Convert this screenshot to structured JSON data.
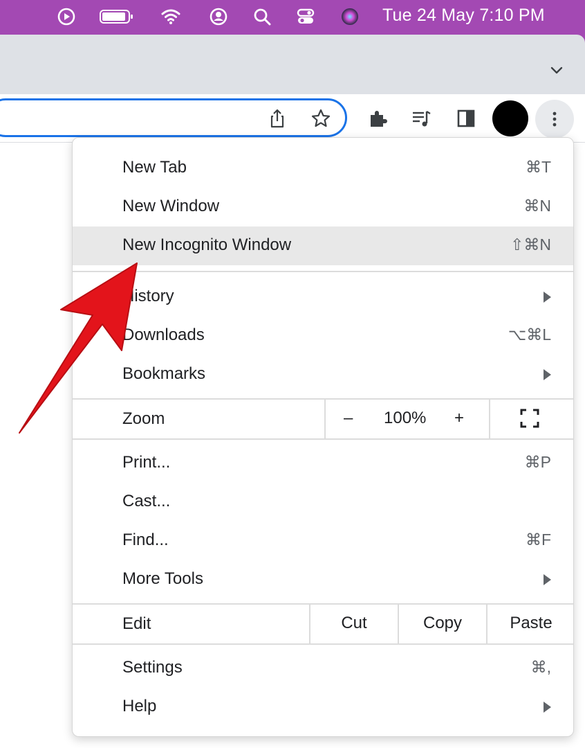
{
  "menubar": {
    "clock": "Tue 24 May  7:10 PM",
    "icons": [
      "play-circle-icon",
      "battery-icon",
      "wifi-icon",
      "user-account-icon",
      "spotlight-search-icon",
      "control-center-icon",
      "siri-icon"
    ],
    "background": "#a349b3"
  },
  "tabstrip": {
    "chevron_icon": "chevron-down-icon"
  },
  "toolbar": {
    "omnibox_icons": [
      "share-icon",
      "bookmark-star-icon"
    ],
    "icons": [
      "extensions-icon",
      "media-controls-icon",
      "side-panel-icon",
      "profile-avatar",
      "chrome-menu-icon"
    ],
    "omnibox_border": "#1a73e8"
  },
  "menu": {
    "groups": [
      {
        "items": [
          {
            "label": "New Tab",
            "shortcut": "⌘T"
          },
          {
            "label": "New Window",
            "shortcut": "⌘N"
          },
          {
            "label": "New Incognito Window",
            "shortcut": "⇧⌘N",
            "highlighted": true
          }
        ]
      },
      {
        "items": [
          {
            "label": "History",
            "submenu": true
          },
          {
            "label": "Downloads",
            "shortcut": "⌥⌘L"
          },
          {
            "label": "Bookmarks",
            "submenu": true
          }
        ]
      }
    ],
    "zoom": {
      "label": "Zoom",
      "minus": "–",
      "value": "100%",
      "plus": "+",
      "fullscreen_icon": "fullscreen-icon"
    },
    "tools": [
      {
        "label": "Print...",
        "shortcut": "⌘P"
      },
      {
        "label": "Cast..."
      },
      {
        "label": "Find...",
        "shortcut": "⌘F"
      },
      {
        "label": "More Tools",
        "submenu": true
      }
    ],
    "edit": {
      "label": "Edit",
      "cut": "Cut",
      "copy": "Copy",
      "paste": "Paste"
    },
    "bottom": [
      {
        "label": "Settings",
        "shortcut": "⌘,"
      },
      {
        "label": "Help",
        "submenu": true
      }
    ]
  },
  "annotation": {
    "arrow_color": "#e3141b"
  }
}
